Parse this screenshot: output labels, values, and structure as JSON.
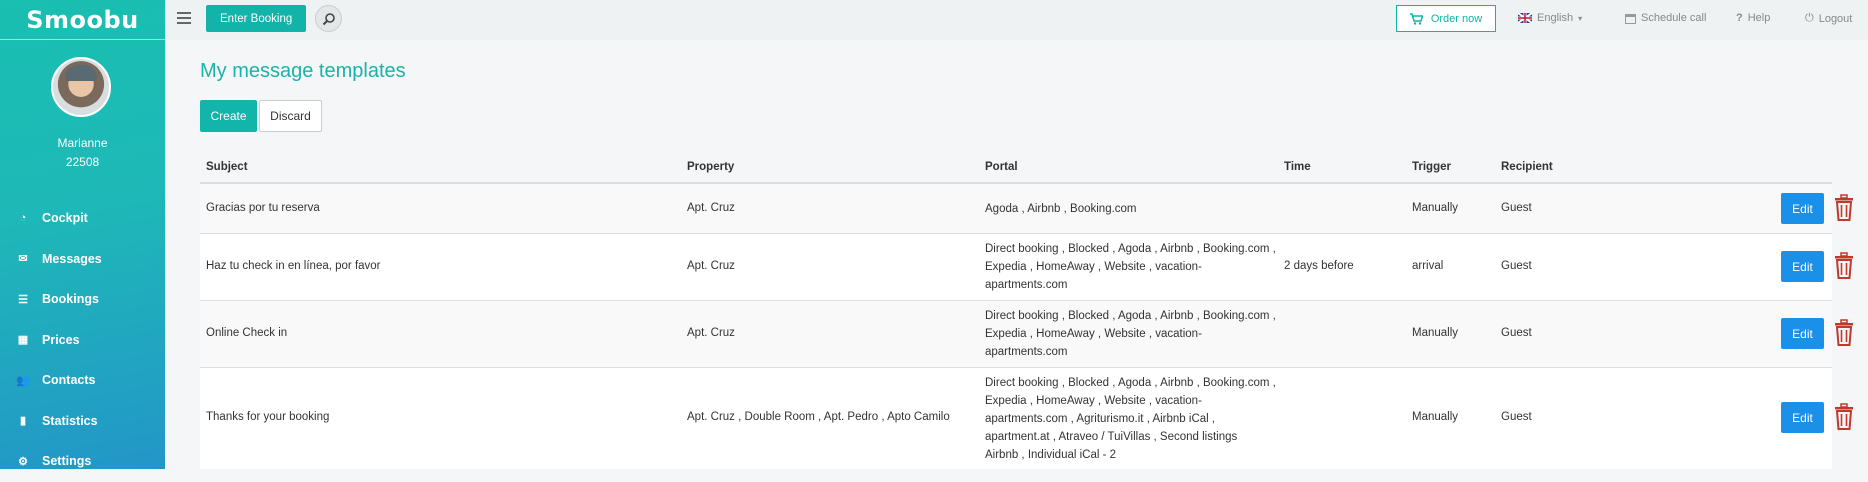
{
  "app": {
    "logo_text": "Smoobu"
  },
  "user": {
    "name": "Marianne",
    "id": "22508"
  },
  "sidebar": {
    "items": [
      {
        "label": "Cockpit",
        "icon": "dashboard-icon"
      },
      {
        "label": "Messages",
        "icon": "envelope-icon"
      },
      {
        "label": "Bookings",
        "icon": "list-icon"
      },
      {
        "label": "Prices",
        "icon": "calculator-icon"
      },
      {
        "label": "Contacts",
        "icon": "users-icon"
      },
      {
        "label": "Statistics",
        "icon": "bar-chart-icon"
      },
      {
        "label": "Settings",
        "icon": "gear-icon"
      }
    ]
  },
  "topbar": {
    "enter_booking": "Enter Booking",
    "order_now": "Order now",
    "language": "English",
    "schedule_call": "Schedule call",
    "help": "Help",
    "logout": "Logout"
  },
  "page": {
    "title": "My message templates",
    "create_label": "Create",
    "discard_label": "Discard"
  },
  "table": {
    "headers": {
      "subject": "Subject",
      "property": "Property",
      "portal": "Portal",
      "time": "Time",
      "trigger": "Trigger",
      "recipient": "Recipient"
    },
    "edit_label": "Edit",
    "rows": [
      {
        "subject": "Gracias por tu reserva",
        "property": "Apt. Cruz",
        "portal_lines": [
          "Agoda , Airbnb , Booking.com"
        ],
        "time": "",
        "trigger": "Manually",
        "recipient": "Guest"
      },
      {
        "subject": "Haz tu check in en línea, por favor",
        "property": "Apt. Cruz",
        "portal_lines": [
          "Direct booking , Blocked , Agoda , Airbnb , Booking.com ,",
          "Expedia , HomeAway , Website , vacation-",
          "apartments.com"
        ],
        "time": "2 days before",
        "trigger": "arrival",
        "recipient": "Guest"
      },
      {
        "subject": "Online Check in",
        "property": "Apt. Cruz",
        "portal_lines": [
          "Direct booking , Blocked , Agoda , Airbnb , Booking.com ,",
          "Expedia , HomeAway , Website , vacation-",
          "apartments.com"
        ],
        "time": "",
        "trigger": "Manually",
        "recipient": "Guest"
      },
      {
        "subject": "Thanks for your booking",
        "property": "Apt. Cruz , Double Room , Apt. Pedro , Apto Camilo",
        "portal_lines": [
          "Direct booking , Blocked , Agoda , Airbnb , Booking.com ,",
          "Expedia , HomeAway , Website , vacation-",
          "apartments.com , Agriturismo.it , Airbnb iCal ,",
          "apartment.at , Atraveo / TuiVillas , Second listings",
          "Airbnb , Individual iCal - 2"
        ],
        "time": "",
        "trigger": "Manually",
        "recipient": "Guest"
      }
    ]
  }
}
